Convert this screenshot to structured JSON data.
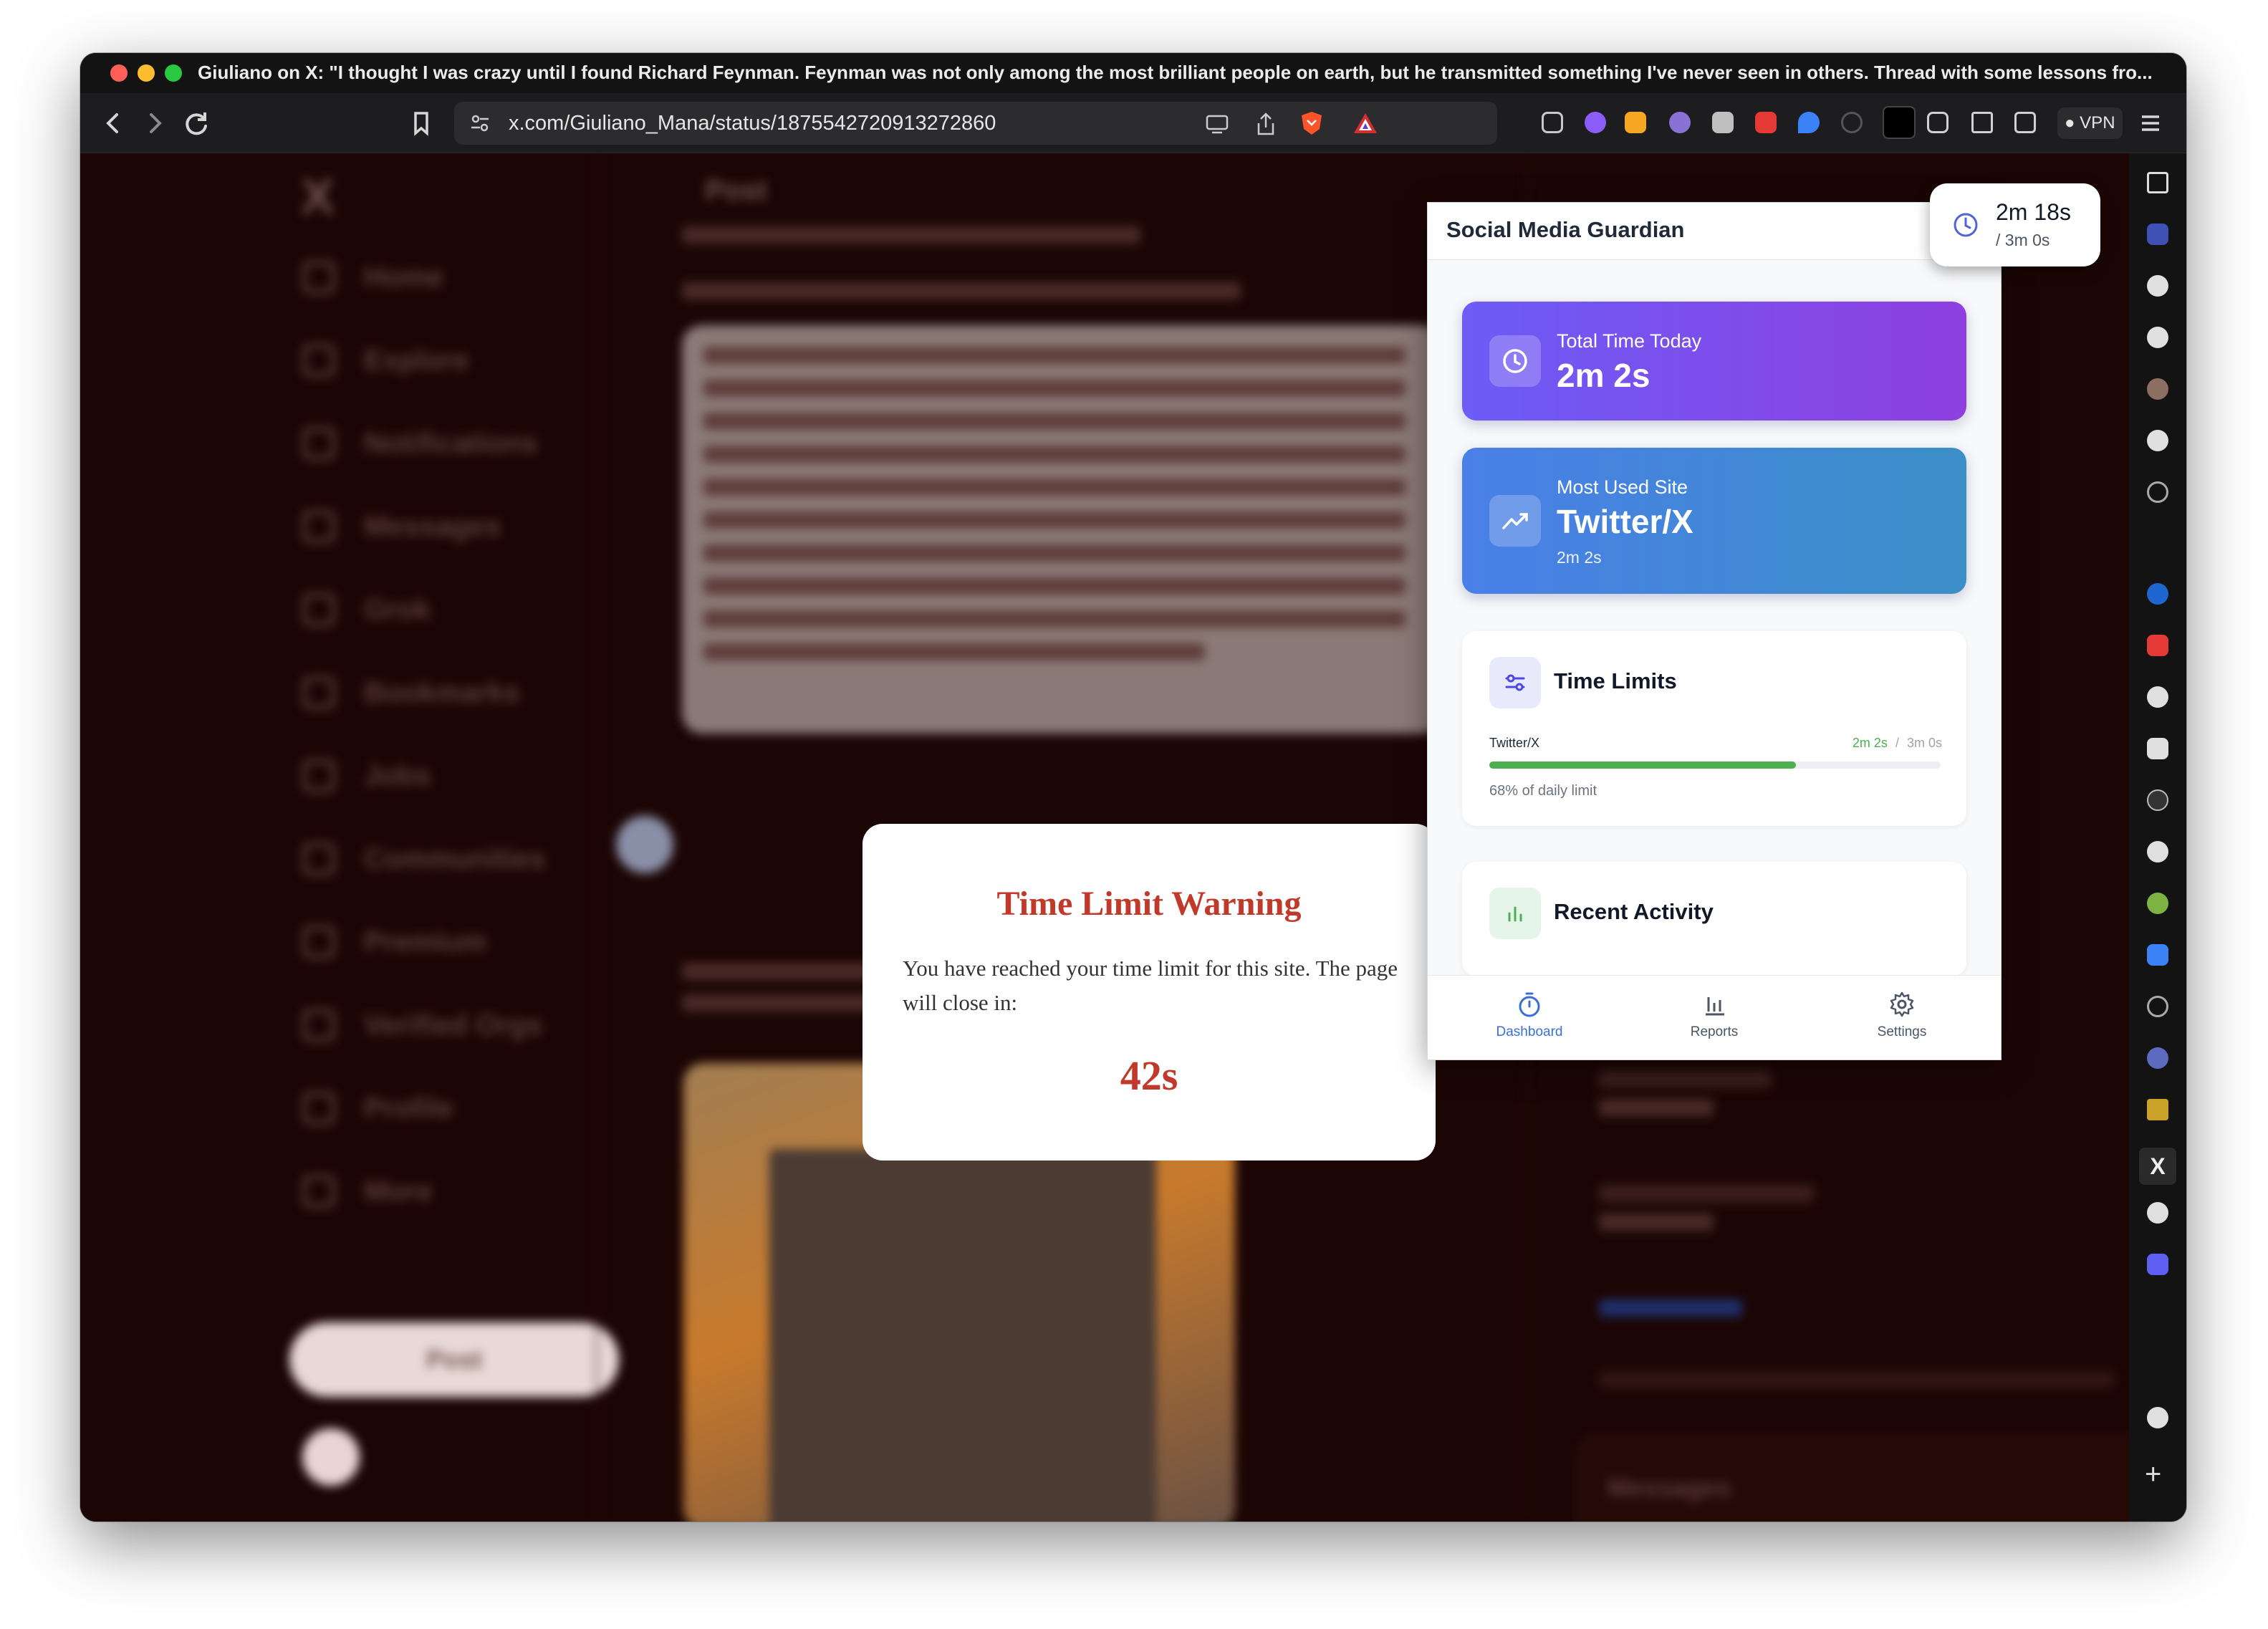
{
  "window": {
    "title": "Giuliano on X: \"I thought I was crazy until I found Richard Feynman. Feynman was not only among the most brilliant people on earth, but he transmitted something I've never seen in others. Thread with some lessons fro...",
    "url": "x.com/Giuliano_Mana/status/1875542720913272860",
    "vpn_label": "VPN"
  },
  "page_blurred": {
    "nav_items": [
      "Home",
      "Explore",
      "Notifications",
      "Messages",
      "Grok",
      "Bookmarks",
      "Jobs",
      "Communities",
      "Premium",
      "Verified Orgs",
      "Profile",
      "More"
    ],
    "post_button": "Post",
    "header_title": "Post",
    "messages_title": "Messages"
  },
  "warning": {
    "title": "Time Limit Warning",
    "message": "You have reached your time limit for this site. The page will close in:",
    "countdown": "42s"
  },
  "extension": {
    "title": "Social Media Guardian",
    "total_time": {
      "label": "Total Time Today",
      "value": "2m 2s"
    },
    "most_used": {
      "label": "Most Used Site",
      "value": "Twitter/X",
      "sub": "2m 2s"
    },
    "time_limits": {
      "title": "Time Limits",
      "site": "Twitter/X",
      "used": "2m 2s",
      "separator": "/",
      "limit": "3m 0s",
      "percent": 68,
      "percent_text": "68% of daily limit"
    },
    "recent_activity": {
      "title": "Recent Activity"
    },
    "nav": [
      {
        "label": "Dashboard",
        "icon": "stopwatch-icon",
        "active": true
      },
      {
        "label": "Reports",
        "icon": "bar-chart-icon",
        "active": false
      },
      {
        "label": "Settings",
        "icon": "gear-icon",
        "active": false
      }
    ]
  },
  "timer_badge": {
    "elapsed": "2m 18s",
    "limit": "/ 3m 0s"
  },
  "colors": {
    "warning_red": "#c0392b",
    "total_card_from": "#6d5cf6",
    "total_card_to": "#8e3fe0",
    "most_used_from": "#4a7fe8",
    "most_used_to": "#3b8fc7",
    "progress_green": "#4caf50",
    "active_nav": "#3b6fd8"
  }
}
